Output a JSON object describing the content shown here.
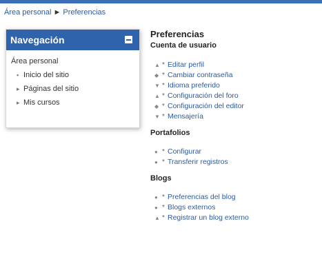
{
  "colors": {
    "accent": "#2f64ac",
    "link": "#2c5aa0",
    "top_bar": "#3a6fb5"
  },
  "breadcrumb": {
    "items": [
      "Área personal",
      "Preferencias"
    ],
    "separator": "►"
  },
  "navigation": {
    "title": "Navegación",
    "collapse_icon": "minus-icon",
    "items": [
      {
        "label": "Área personal",
        "marker": ""
      },
      {
        "label": "Inicio del sitio",
        "marker": "▪"
      },
      {
        "label": "Páginas del sitio",
        "marker": "▸"
      },
      {
        "label": "Mis cursos",
        "marker": "▸"
      }
    ]
  },
  "main": {
    "title": "Preferencias",
    "sections": [
      {
        "title": "Cuenta de usuario",
        "links": [
          {
            "label": "Editar perfil",
            "icon": "▲"
          },
          {
            "label": "Cambiar contraseña",
            "icon": "◆"
          },
          {
            "label": "Idioma preferido",
            "icon": "▼"
          },
          {
            "label": "Configuración del foro",
            "icon": "▲"
          },
          {
            "label": "Configuración del editor",
            "icon": "◆"
          },
          {
            "label": "Mensajería",
            "icon": "▼"
          }
        ]
      },
      {
        "title": "Portafolios",
        "links": [
          {
            "label": "Configurar",
            "icon": "●"
          },
          {
            "label": "Transferir registros",
            "icon": "●"
          }
        ]
      },
      {
        "title": "Blogs",
        "links": [
          {
            "label": "Preferencias del blog",
            "icon": "●"
          },
          {
            "label": "Blogs externos",
            "icon": "●"
          },
          {
            "label": "Registrar un blog externo",
            "icon": "▲"
          }
        ]
      }
    ]
  }
}
